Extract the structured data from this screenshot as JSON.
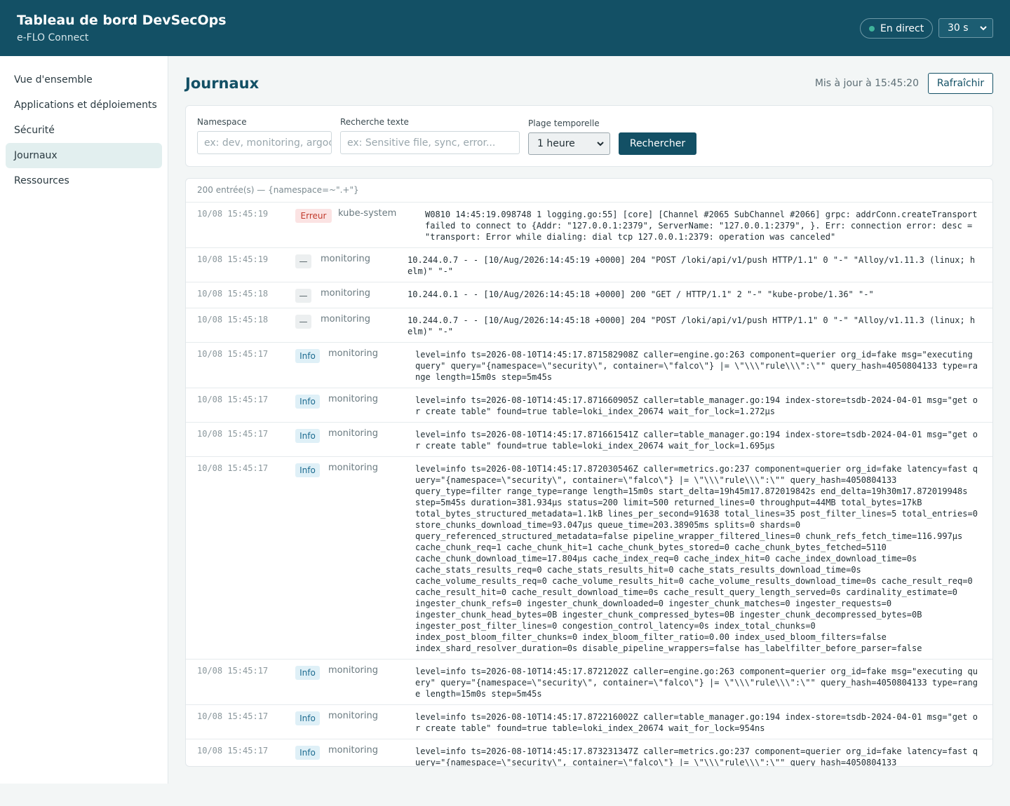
{
  "header": {
    "title": "Tableau de bord DevSecOps",
    "subtitle": "e-FLO Connect",
    "live_label": "En direct",
    "interval": "30 s"
  },
  "sidebar": {
    "items": [
      {
        "label": "Vue d'ensemble"
      },
      {
        "label": "Applications et déploiements"
      },
      {
        "label": "Sécurité"
      },
      {
        "label": "Journaux",
        "active": true
      },
      {
        "label": "Ressources"
      }
    ]
  },
  "main": {
    "title": "Journaux",
    "updated": "Mis à jour à 15:45:20",
    "refresh_label": "Rafraîchir"
  },
  "filters": {
    "namespace_label": "Namespace",
    "namespace_placeholder": "ex: dev, monitoring, argocd",
    "text_label": "Recherche texte",
    "text_placeholder": "ex: Sensitive file, sync, error...",
    "range_label": "Plage temporelle",
    "range_value": "1 heure",
    "search_label": "Rechercher"
  },
  "logs": {
    "count": "200 entrée(s) — {namespace=~\".+\"}",
    "entries": [
      {
        "time": "10/08 15:45:19",
        "level": "Erreur",
        "namespace": "kube-system",
        "message": "W0810 14:45:19.098748 1 logging.go:55] [core] [Channel #2065 SubChannel #2066] grpc: addrConn.createTransport failed to connect to {Addr: \"127.0.0.1:2379\", ServerName: \"127.0.0.1:2379\", }. Err: connection error: desc = \"transport: Error while dialing: dial tcp 127.0.0.1:2379: operation was canceled\""
      },
      {
        "time": "10/08 15:45:19",
        "level": "—",
        "namespace": "monitoring",
        "message": "10.244.0.7 - - [10/Aug/2026:14:45:19 +0000] 204 \"POST /loki/api/v1/push HTTP/1.1\" 0 \"-\" \"Alloy/v1.11.3 (linux; helm)\" \"-\""
      },
      {
        "time": "10/08 15:45:18",
        "level": "—",
        "namespace": "monitoring",
        "message": "10.244.0.1 - - [10/Aug/2026:14:45:18 +0000] 200 \"GET / HTTP/1.1\" 2 \"-\" \"kube-probe/1.36\" \"-\""
      },
      {
        "time": "10/08 15:45:18",
        "level": "—",
        "namespace": "monitoring",
        "message": "10.244.0.7 - - [10/Aug/2026:14:45:18 +0000] 204 \"POST /loki/api/v1/push HTTP/1.1\" 0 \"-\" \"Alloy/v1.11.3 (linux; helm)\" \"-\""
      },
      {
        "time": "10/08 15:45:17",
        "level": "Info",
        "namespace": "monitoring",
        "message": "level=info ts=2026-08-10T14:45:17.871582908Z caller=engine.go:263 component=querier org_id=fake msg=\"executing query\" query=\"{namespace=\\\"security\\\", container=\\\"falco\\\"} |= \\\"\\\\\\\"rule\\\\\\\":\\\"\" query_hash=4050804133 type=range length=15m0s step=5m45s"
      },
      {
        "time": "10/08 15:45:17",
        "level": "Info",
        "namespace": "monitoring",
        "message": "level=info ts=2026-08-10T14:45:17.871660905Z caller=table_manager.go:194 index-store=tsdb-2024-04-01 msg=\"get or create table\" found=true table=loki_index_20674 wait_for_lock=1.272µs"
      },
      {
        "time": "10/08 15:45:17",
        "level": "Info",
        "namespace": "monitoring",
        "message": "level=info ts=2026-08-10T14:45:17.871661541Z caller=table_manager.go:194 index-store=tsdb-2024-04-01 msg=\"get or create table\" found=true table=loki_index_20674 wait_for_lock=1.695µs"
      },
      {
        "time": "10/08 15:45:17",
        "level": "Info",
        "namespace": "monitoring",
        "message": "level=info ts=2026-08-10T14:45:17.872030546Z caller=metrics.go:237 component=querier org_id=fake latency=fast query=\"{namespace=\\\"security\\\", container=\\\"falco\\\"} |= \\\"\\\\\\\"rule\\\\\\\":\\\"\" query_hash=4050804133\nquery_type=filter range_type=range length=15m0s start_delta=19h45m17.872019842s end_delta=19h30m17.872019948s\nstep=5m45s duration=381.934µs status=200 limit=500 returned_lines=0 throughput=44MB total_bytes=17kB\ntotal_bytes_structured_metadata=1.1kB lines_per_second=91638 total_lines=35 post_filter_lines=5 total_entries=0\nstore_chunks_download_time=93.047µs queue_time=203.38905ms splits=0 shards=0\nquery_referenced_structured_metadata=false pipeline_wrapper_filtered_lines=0 chunk_refs_fetch_time=116.997µs\ncache_chunk_req=1 cache_chunk_hit=1 cache_chunk_bytes_stored=0 cache_chunk_bytes_fetched=5110\ncache_chunk_download_time=17.804µs cache_index_req=0 cache_index_hit=0 cache_index_download_time=0s\ncache_stats_results_req=0 cache_stats_results_hit=0 cache_stats_results_download_time=0s\ncache_volume_results_req=0 cache_volume_results_hit=0 cache_volume_results_download_time=0s cache_result_req=0\ncache_result_hit=0 cache_result_download_time=0s cache_result_query_length_served=0s cardinality_estimate=0\ningester_chunk_refs=0 ingester_chunk_downloaded=0 ingester_chunk_matches=0 ingester_requests=0\ningester_chunk_head_bytes=0B ingester_chunk_compressed_bytes=0B ingester_chunk_decompressed_bytes=0B\ningester_post_filter_lines=0 congestion_control_latency=0s index_total_chunks=0\nindex_post_bloom_filter_chunks=0 index_bloom_filter_ratio=0.00 index_used_bloom_filters=false\nindex_shard_resolver_duration=0s disable_pipeline_wrappers=false has_labelfilter_before_parser=false"
      },
      {
        "time": "10/08 15:45:17",
        "level": "Info",
        "namespace": "monitoring",
        "message": "level=info ts=2026-08-10T14:45:17.8721202Z caller=engine.go:263 component=querier org_id=fake msg=\"executing query\" query=\"{namespace=\\\"security\\\", container=\\\"falco\\\"} |= \\\"\\\\\\\"rule\\\\\\\":\\\"\" query_hash=4050804133 type=range length=15m0s step=5m45s"
      },
      {
        "time": "10/08 15:45:17",
        "level": "Info",
        "namespace": "monitoring",
        "message": "level=info ts=2026-08-10T14:45:17.872216002Z caller=table_manager.go:194 index-store=tsdb-2024-04-01 msg=\"get or create table\" found=true table=loki_index_20674 wait_for_lock=954ns"
      },
      {
        "time": "10/08 15:45:17",
        "level": "Info",
        "namespace": "monitoring",
        "message": "level=info ts=2026-08-10T14:45:17.873231347Z caller=metrics.go:237 component=querier org_id=fake latency=fast query=\"{namespace=\\\"security\\\", container=\\\"falco\\\"} |= \\\"\\\\\\\"rule\\\\\\\":\\\"\" query_hash=4050804133"
      }
    ]
  }
}
